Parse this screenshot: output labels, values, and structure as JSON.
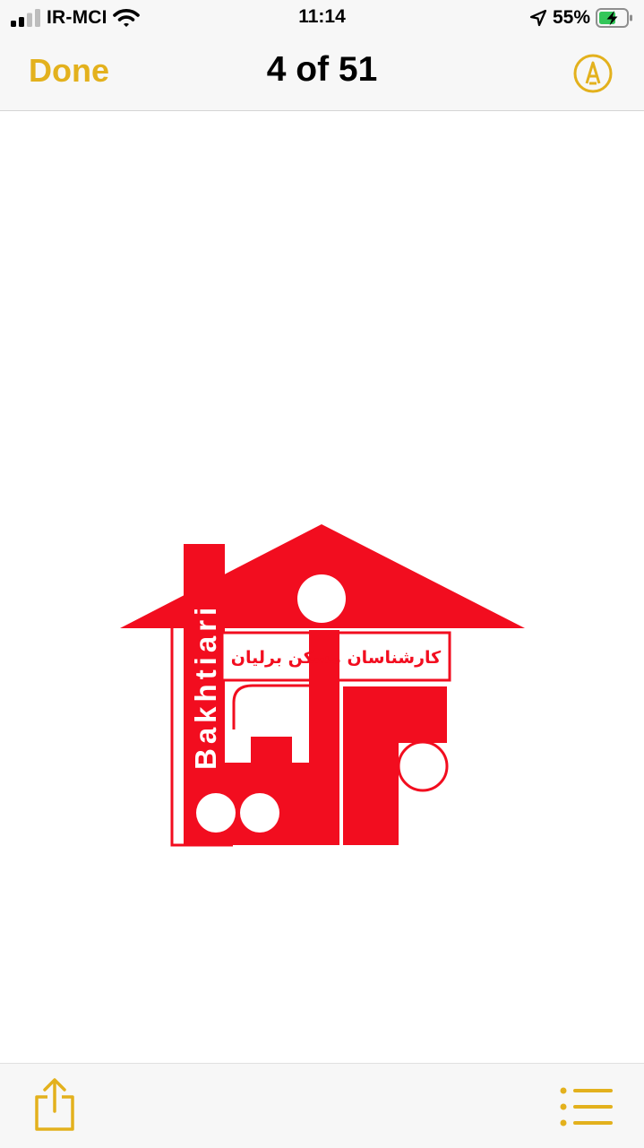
{
  "status_bar": {
    "carrier": "IR-MCI",
    "time": "11:14",
    "battery_percent": "55%",
    "signal_icon": "cellular-signal-icon",
    "wifi_icon": "wifi-icon",
    "location_icon": "location-arrow-icon",
    "battery_icon": "battery-charging-icon",
    "battery_level": 0.55
  },
  "nav": {
    "done_label": "Done",
    "title": "4 of 51",
    "markup_icon": "markup-pen-icon",
    "accent_color": "#e3b11d"
  },
  "image": {
    "logo_vertical_text": "Bakhtiari",
    "logo_persian_text": "کارشناسان مسکن برلیان",
    "logo_color": "#f20d1f"
  },
  "toolbar": {
    "share_icon": "share-icon",
    "list_icon": "list-icon"
  }
}
